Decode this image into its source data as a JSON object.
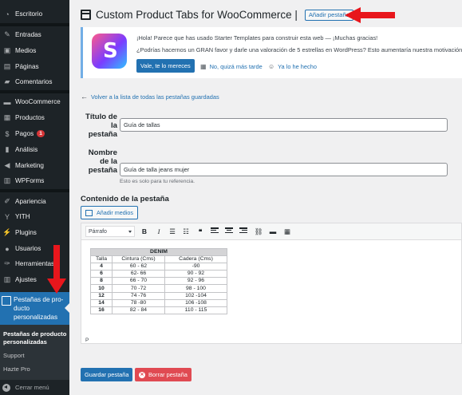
{
  "sidebar": {
    "items": [
      {
        "label": "Escritorio",
        "icon": "dashboard-icon"
      },
      {
        "label": "Entradas",
        "icon": "pin-icon"
      },
      {
        "label": "Medios",
        "icon": "media-icon"
      },
      {
        "label": "Páginas",
        "icon": "pages-icon"
      },
      {
        "label": "Comentarios",
        "icon": "comments-icon"
      },
      {
        "label": "WooCommerce",
        "icon": "woocommerce-icon"
      },
      {
        "label": "Productos",
        "icon": "products-icon"
      },
      {
        "label": "Pagos",
        "icon": "payments-icon",
        "badge": "1"
      },
      {
        "label": "Análisis",
        "icon": "analytics-icon"
      },
      {
        "label": "Marketing",
        "icon": "megaphone-icon"
      },
      {
        "label": "WPForms",
        "icon": "forms-icon"
      },
      {
        "label": "Apariencia",
        "icon": "brush-icon"
      },
      {
        "label": "YITH",
        "icon": "yith-icon"
      },
      {
        "label": "Plugins",
        "icon": "plugin-icon"
      },
      {
        "label": "Usuarios",
        "icon": "users-icon"
      },
      {
        "label": "Herramientas",
        "icon": "wrench-icon"
      },
      {
        "label": "Ajustes",
        "icon": "settings-icon"
      }
    ],
    "active": {
      "label": "Pestañas de pro-ducto personalizadas",
      "icon": "tabs-icon"
    },
    "submenu": {
      "current": "Pestañas de producto personalizadas",
      "support": "Support",
      "pro": "Hazte Pro"
    },
    "collapse": "Cerrar menú"
  },
  "header": {
    "title": "Custom Product Tabs for WooCommerce |",
    "add_button": "Añadir pestaña"
  },
  "notice": {
    "line1": "¡Hola! Parece que has usado Starter Templates para construir esta web — ¡Muchas gracias!",
    "line2": "¿Podrías hacernos un GRAN favor y darle una valoración de 5 estrellas en WordPress? Esto aumentaría nuestra motivación y",
    "rate_button": "Vale, te lo mereces",
    "later_link": "No, quizá más tarde",
    "done_link": "Ya lo he hecho",
    "logo_letter": "S"
  },
  "back_link": "Volver a la lista de todas las pestañas guardadas",
  "form": {
    "tab_title_label_1": "Título de",
    "tab_title_label_2": "la pestaña",
    "tab_title_value": "Guía de tallas",
    "tab_name_label_1": "Nombre",
    "tab_name_label_2": "de la",
    "tab_name_label_3": "pestaña",
    "tab_name_value": "Guía de talla jeans mujer",
    "tab_name_desc": "Esto es solo para tu referencia.",
    "content_title": "Contenido de la pestaña",
    "media_button": "Añadir medios"
  },
  "editor": {
    "format_select": "Párrafo",
    "footer_path": "P",
    "table": {
      "title": "DENIM",
      "headers": [
        "Talla",
        "Cintura (Cms)",
        "Cadera (Cms)"
      ],
      "rows": [
        [
          "4",
          "60 - 62",
          "-90"
        ],
        [
          "6",
          "62- 66",
          "90 - 92"
        ],
        [
          "8",
          "66 - 70",
          "92 - 96"
        ],
        [
          "10",
          "70 -72",
          "98 - 100"
        ],
        [
          "12",
          "74 -76",
          "102 -104"
        ],
        [
          "14",
          "78 -80",
          "106 -108"
        ],
        [
          "16",
          "82 - 84",
          "110 - 115"
        ]
      ]
    }
  },
  "actions": {
    "save": "Guardar pestaña",
    "delete": "Borrar pestaña"
  },
  "colors": {
    "sidebar_bg": "#1d2327",
    "accent": "#2271b1",
    "delete": "#e04a52",
    "annotation_arrow": "#e8161c"
  }
}
